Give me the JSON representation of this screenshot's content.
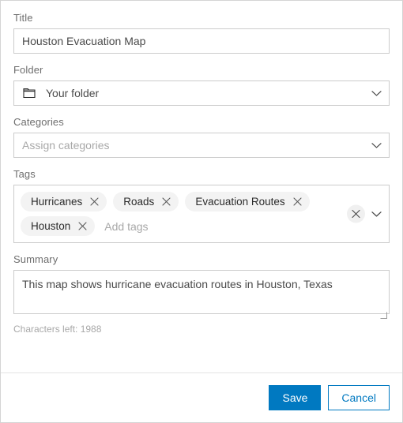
{
  "form": {
    "title_field": {
      "label": "Title",
      "value": "Houston Evacuation Map",
      "placeholder": "Title"
    },
    "folder_field": {
      "label": "Folder",
      "value": "Your folder",
      "icon": "folder-icon",
      "chevron": "chevron-down-icon"
    },
    "categories_field": {
      "label": "Categories",
      "value": "Assign categories",
      "is_placeholder": true,
      "chevron": "chevron-down-icon"
    },
    "tags_field": {
      "label": "Tags",
      "tags": [
        "Hurricanes",
        "Roads",
        "Evacuation Routes",
        "Houston"
      ],
      "input_placeholder": "Add tags",
      "input_value": "",
      "remove_icon": "close-icon",
      "clear_all_icon": "close-icon",
      "chevron": "chevron-down-icon"
    },
    "summary_field": {
      "label": "Summary",
      "value": "This map shows hurricane evacuation routes in Houston, Texas",
      "placeholder": "Summary",
      "characters_left": "Characters left: 1988"
    }
  },
  "footer": {
    "save_label": "Save",
    "cancel_label": "Cancel"
  },
  "colors": {
    "accent": "#0079c1",
    "label_text": "#6e6e6e",
    "input_text": "#4a4a4a",
    "placeholder_text": "#a8a8a8",
    "border": "#cccccc",
    "chip_background": "#f3f3f3",
    "panel_border": "#d4d4d4"
  }
}
